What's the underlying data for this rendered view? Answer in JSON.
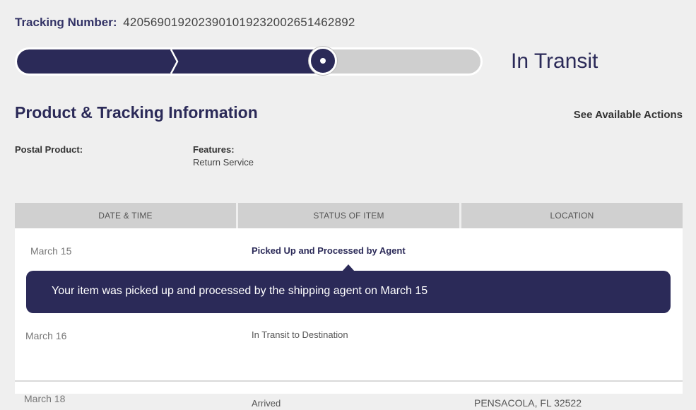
{
  "tracking": {
    "label": "Tracking Number:",
    "number": "420569019202390101923200265146289​2"
  },
  "progress": {
    "status": "In Transit",
    "fill_fraction": 0.66
  },
  "section": {
    "title": "Product & Tracking Information",
    "actions_link": "See Available Actions"
  },
  "meta": {
    "postal_product_label": "Postal Product:",
    "features_label": "Features:",
    "features_value": "Return Service"
  },
  "table": {
    "headers": [
      "DATE & TIME",
      "STATUS OF ITEM",
      "LOCATION"
    ],
    "rows": [
      {
        "date": "March 15",
        "status": "Picked Up and Processed by Agent",
        "location": ""
      },
      {
        "date": "March 16",
        "status": "In Transit to Destination",
        "location": ""
      },
      {
        "date": "March 18",
        "status": "Arrived",
        "location": "PENSACOLA, FL 32522"
      }
    ]
  },
  "tooltip": {
    "text": "Your item was picked up and processed by the shipping agent on March 15"
  },
  "colors": {
    "brand": "#2b2a58",
    "header_bg": "#d0d0d0",
    "page_bg": "#efefef"
  }
}
